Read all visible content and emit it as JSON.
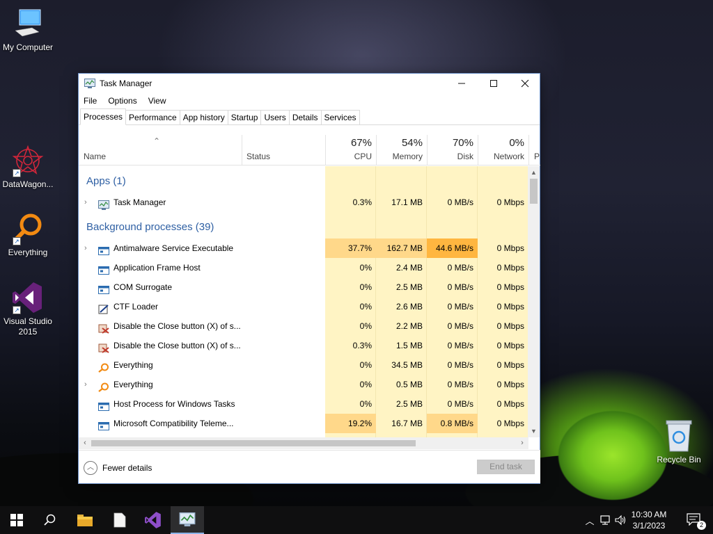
{
  "desktop": {
    "icons": [
      {
        "label": "My Computer",
        "icon": "computer-icon"
      },
      {
        "label": "DataWagon...",
        "icon": "datawagon-icon"
      },
      {
        "label": "Everything",
        "icon": "everything-icon"
      },
      {
        "label": "Visual Studio 2015",
        "icon": "visual-studio-icon"
      },
      {
        "label": "Recycle Bin",
        "icon": "recycle-bin-icon"
      }
    ]
  },
  "window": {
    "title": "Task Manager",
    "menu": [
      "File",
      "Options",
      "View"
    ],
    "tabs": [
      "Processes",
      "Performance",
      "App history",
      "Startup",
      "Users",
      "Details",
      "Services"
    ],
    "active_tab": "Processes"
  },
  "columns": {
    "name": "Name",
    "status": "Status",
    "cpu": {
      "pct": "67%",
      "label": "CPU"
    },
    "memory": {
      "pct": "54%",
      "label": "Memory"
    },
    "disk": {
      "pct": "70%",
      "label": "Disk"
    },
    "network": {
      "pct": "0%",
      "label": "Network"
    },
    "power_partial": "P"
  },
  "groups": {
    "apps": "Apps (1)",
    "background": "Background processes (39)"
  },
  "apps": [
    {
      "name": "Task Manager",
      "cpu": "0.3%",
      "memory": "17.1 MB",
      "disk": "0 MB/s",
      "network": "0 Mbps",
      "expandable": true,
      "icon": "task-manager-icon"
    }
  ],
  "background": [
    {
      "name": "Antimalware Service Executable",
      "cpu": "37.7%",
      "memory": "162.7 MB",
      "disk": "44.6 MB/s",
      "network": "0 Mbps",
      "expandable": true,
      "icon": "service-window-icon"
    },
    {
      "name": "Application Frame Host",
      "cpu": "0%",
      "memory": "2.4 MB",
      "disk": "0 MB/s",
      "network": "0 Mbps",
      "expandable": false,
      "icon": "service-window-icon"
    },
    {
      "name": "COM Surrogate",
      "cpu": "0%",
      "memory": "2.5 MB",
      "disk": "0 MB/s",
      "network": "0 Mbps",
      "expandable": false,
      "icon": "service-window-icon"
    },
    {
      "name": "CTF Loader",
      "cpu": "0%",
      "memory": "2.6 MB",
      "disk": "0 MB/s",
      "network": "0 Mbps",
      "expandable": false,
      "icon": "ctf-loader-icon"
    },
    {
      "name": "Disable the Close button (X) of s...",
      "cpu": "0%",
      "memory": "2.2 MB",
      "disk": "0 MB/s",
      "network": "0 Mbps",
      "expandable": false,
      "icon": "disable-close-icon"
    },
    {
      "name": "Disable the Close button (X) of s...",
      "cpu": "0.3%",
      "memory": "1.5 MB",
      "disk": "0 MB/s",
      "network": "0 Mbps",
      "expandable": false,
      "icon": "disable-close-icon"
    },
    {
      "name": "Everything",
      "cpu": "0%",
      "memory": "34.5 MB",
      "disk": "0 MB/s",
      "network": "0 Mbps",
      "expandable": false,
      "icon": "everything-icon"
    },
    {
      "name": "Everything",
      "cpu": "0%",
      "memory": "0.5 MB",
      "disk": "0 MB/s",
      "network": "0 Mbps",
      "expandable": true,
      "icon": "everything-icon"
    },
    {
      "name": "Host Process for Windows Tasks",
      "cpu": "0%",
      "memory": "2.5 MB",
      "disk": "0 MB/s",
      "network": "0 Mbps",
      "expandable": false,
      "icon": "service-window-icon"
    },
    {
      "name": "Microsoft Compatibility Teleme...",
      "cpu": "19.2%",
      "memory": "16.7 MB",
      "disk": "0.8 MB/s",
      "network": "0 Mbps",
      "expandable": false,
      "icon": "service-window-icon"
    }
  ],
  "footer": {
    "fewer_details": "Fewer details",
    "end_task": "End task"
  },
  "taskbar": {
    "items": [
      "windows-start-icon",
      "search-icon",
      "file-explorer-icon",
      "notepad-icon",
      "visual-studio-icon",
      "task-manager-icon"
    ],
    "active_item": "task-manager-icon",
    "time": "10:30 AM",
    "date": "3/1/2023",
    "notification_count": "2"
  },
  "colors": {
    "heat_low": "#fff4c4",
    "heat_mid": "#ffd88a",
    "heat_high": "#ffb640",
    "group_header": "#2e5fa3"
  }
}
